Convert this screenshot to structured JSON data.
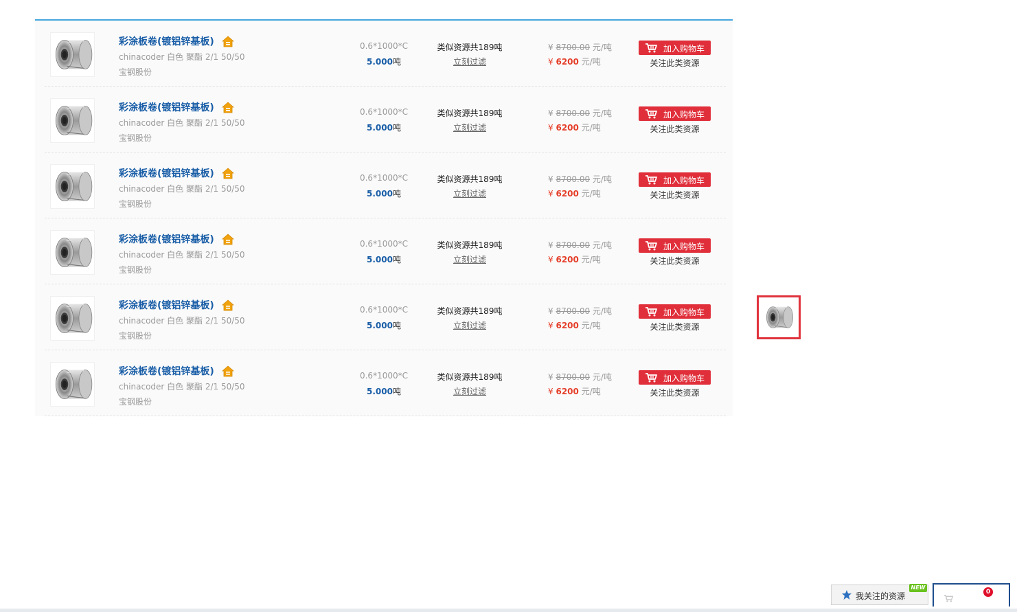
{
  "rows": [
    {
      "name": "彩涂板卷(镀铝锌基板)",
      "spec": "chinacoder 白色 聚酯 2/1 50/50",
      "maker": "宝钢股份",
      "size": "0.6*1000*C",
      "weight": "5.000",
      "weight_unit": "吨",
      "similar": "类似资源共189吨",
      "filter": "立刻过滤",
      "currency": "¥",
      "old_price": "8700.00",
      "new_price": "6200",
      "price_unit": "元/吨",
      "cart_label": "加入购物车",
      "follow_label": "关注此类资源"
    },
    {
      "name": "彩涂板卷(镀铝锌基板)",
      "spec": "chinacoder 白色 聚酯 2/1 50/50",
      "maker": "宝钢股份",
      "size": "0.6*1000*C",
      "weight": "5.000",
      "weight_unit": "吨",
      "similar": "类似资源共189吨",
      "filter": "立刻过滤",
      "currency": "¥",
      "old_price": "8700.00",
      "new_price": "6200",
      "price_unit": "元/吨",
      "cart_label": "加入购物车",
      "follow_label": "关注此类资源"
    },
    {
      "name": "彩涂板卷(镀铝锌基板)",
      "spec": "chinacoder 白色 聚酯 2/1 50/50",
      "maker": "宝钢股份",
      "size": "0.6*1000*C",
      "weight": "5.000",
      "weight_unit": "吨",
      "similar": "类似资源共189吨",
      "filter": "立刻过滤",
      "currency": "¥",
      "old_price": "8700.00",
      "new_price": "6200",
      "price_unit": "元/吨",
      "cart_label": "加入购物车",
      "follow_label": "关注此类资源"
    },
    {
      "name": "彩涂板卷(镀铝锌基板)",
      "spec": "chinacoder 白色 聚酯 2/1 50/50",
      "maker": "宝钢股份",
      "size": "0.6*1000*C",
      "weight": "5.000",
      "weight_unit": "吨",
      "similar": "类似资源共189吨",
      "filter": "立刻过滤",
      "currency": "¥",
      "old_price": "8700.00",
      "new_price": "6200",
      "price_unit": "元/吨",
      "cart_label": "加入购物车",
      "follow_label": "关注此类资源"
    },
    {
      "name": "彩涂板卷(镀铝锌基板)",
      "spec": "chinacoder 白色 聚酯 2/1 50/50",
      "maker": "宝钢股份",
      "size": "0.6*1000*C",
      "weight": "5.000",
      "weight_unit": "吨",
      "similar": "类似资源共189吨",
      "filter": "立刻过滤",
      "currency": "¥",
      "old_price": "8700.00",
      "new_price": "6200",
      "price_unit": "元/吨",
      "cart_label": "加入购物车",
      "follow_label": "关注此类资源"
    },
    {
      "name": "彩涂板卷(镀铝锌基板)",
      "spec": "chinacoder 白色 聚酯 2/1 50/50",
      "maker": "宝钢股份",
      "size": "0.6*1000*C",
      "weight": "5.000",
      "weight_unit": "吨",
      "similar": "类似资源共189吨",
      "filter": "立刻过滤",
      "currency": "¥",
      "old_price": "8700.00",
      "new_price": "6200",
      "price_unit": "元/吨",
      "cart_label": "加入购物车",
      "follow_label": "关注此类资源"
    }
  ],
  "footer": {
    "follow_label": "我关注的资源",
    "new_badge": "NEW",
    "cart_count": "0"
  },
  "colors": {
    "accent_blue": "#44a6de",
    "link_blue": "#1a5ea7",
    "cart_red": "#e02f3a",
    "price_red": "#e53f2a"
  }
}
